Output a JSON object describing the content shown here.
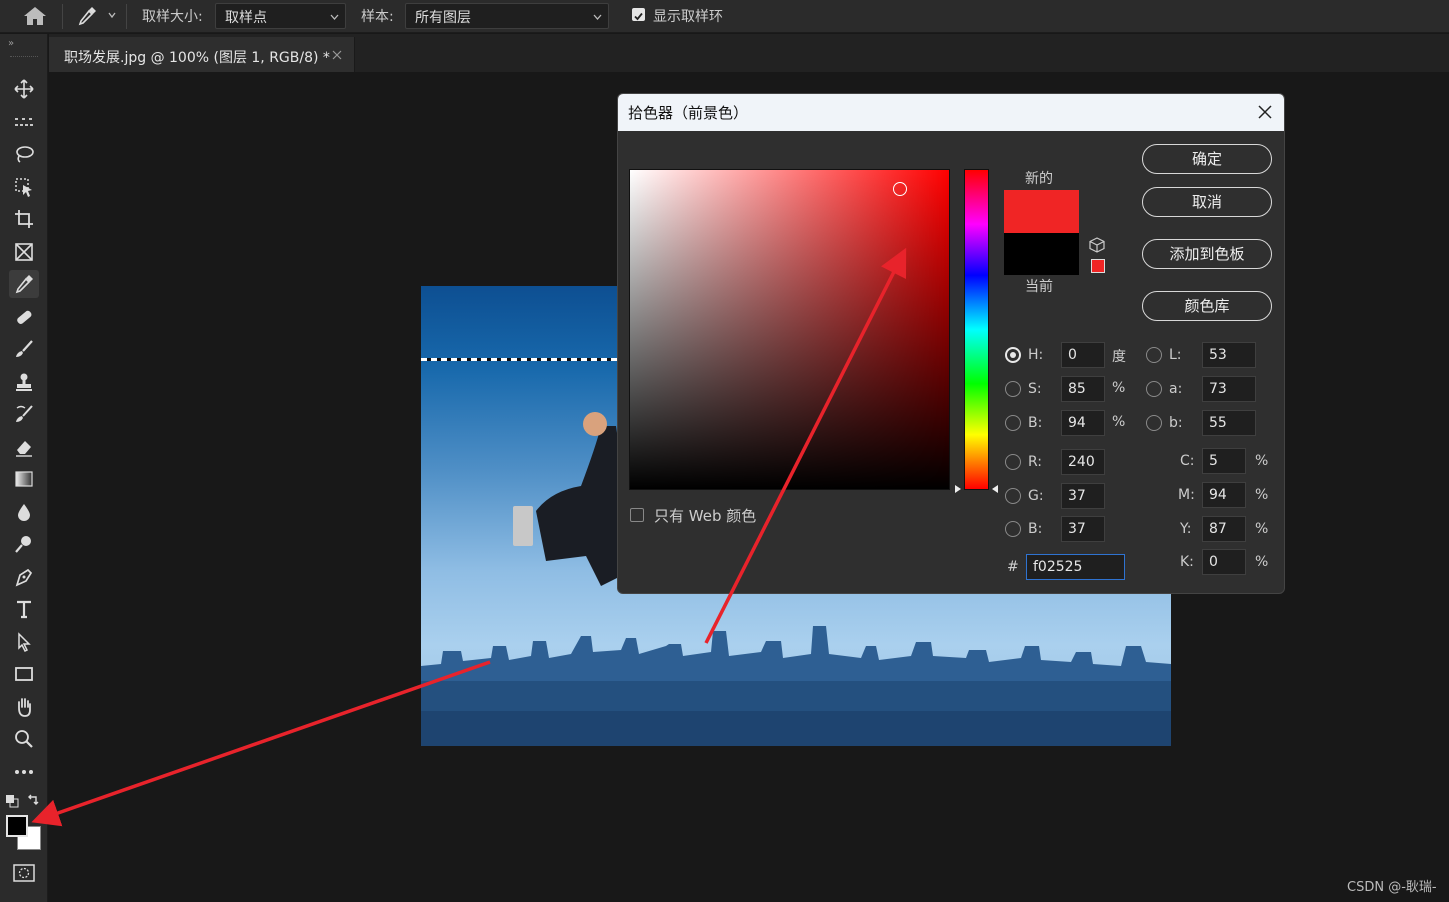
{
  "options_bar": {
    "sample_size_label": "取样大小:",
    "sample_size_value": "取样点",
    "sample_label": "样本:",
    "sample_value": "所有图层",
    "show_ring_label": "显示取样环"
  },
  "document": {
    "tab_title": "职场发展.jpg @ 100% (图层 1, RGB/8) *"
  },
  "color_picker": {
    "title": "拾色器（前景色）",
    "new_label": "新的",
    "current_label": "当前",
    "new_color": "#f02525",
    "current_color": "#000000",
    "buttons": {
      "ok": "确定",
      "cancel": "取消",
      "add_swatch": "添加到色板",
      "color_library": "颜色库"
    },
    "web_only_label": "只有 Web 颜色",
    "hsb": {
      "h_label": "H:",
      "h_value": "0",
      "h_unit": "度",
      "s_label": "S:",
      "s_value": "85",
      "s_unit": "%",
      "b_label": "B:",
      "b_value": "94",
      "b_unit": "%"
    },
    "rgb": {
      "r_label": "R:",
      "r_value": "240",
      "g_label": "G:",
      "g_value": "37",
      "b_label": "B:",
      "b_value": "37"
    },
    "lab": {
      "l_label": "L:",
      "l_value": "53",
      "a_label": "a:",
      "a_value": "73",
      "b_label": "b:",
      "b_value": "55"
    },
    "cmyk": {
      "c_label": "C:",
      "c_value": "5",
      "m_label": "M:",
      "m_value": "94",
      "y_label": "Y:",
      "y_value": "87",
      "k_label": "K:",
      "k_value": "0",
      "unit": "%"
    },
    "hex_label": "#",
    "hex_value": "f02525"
  },
  "colors": {
    "foreground": "#000000",
    "background": "#ffffff",
    "annotation_arrow": "#e8232b"
  },
  "watermark": "CSDN @-耿瑞-"
}
